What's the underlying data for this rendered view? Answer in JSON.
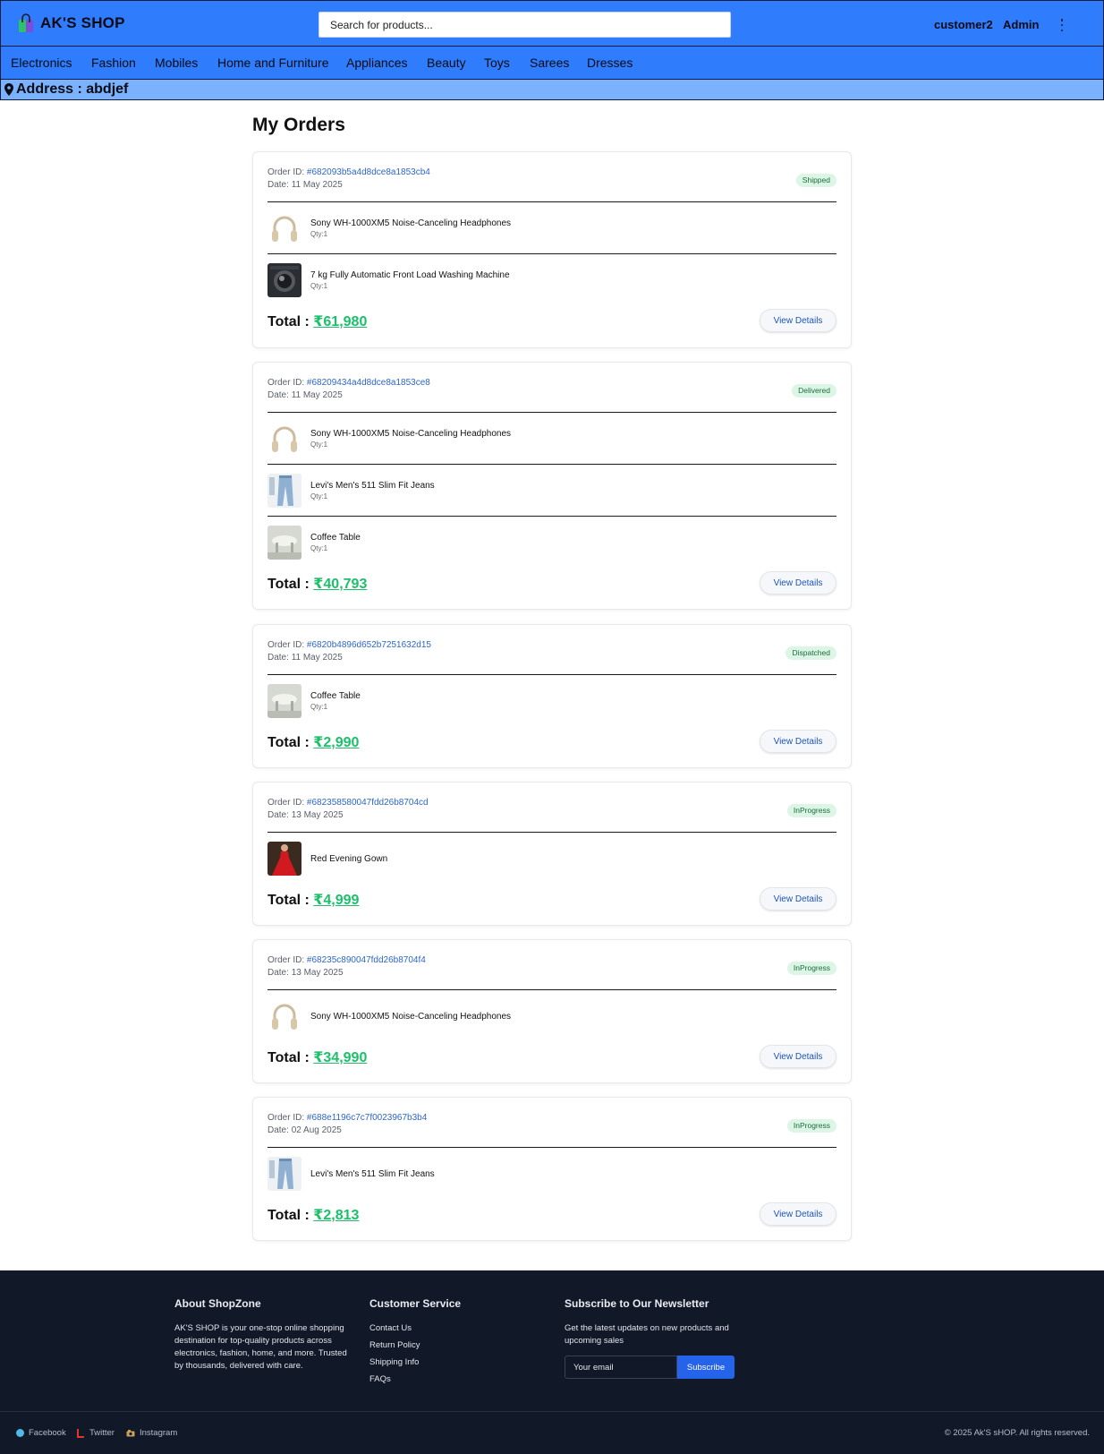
{
  "header": {
    "brand": "AK'S SHOP",
    "search_placeholder": "Search for products...",
    "user": "customer2",
    "admin": "Admin"
  },
  "categories": [
    "Electronics",
    "Fashion",
    "Mobiles",
    "Home and Furniture",
    "Appliances",
    "Beauty",
    "Toys",
    "Sarees",
    "Dresses"
  ],
  "address": "Address : abdjef",
  "page_title": "My Orders",
  "labels": {
    "order_id": "Order ID:",
    "date": "Date:",
    "qty": "Qty:1",
    "total": "Total :",
    "view_details": "View Details"
  },
  "orders": [
    {
      "id": "#682093b5a4d8dce8a1853cb4",
      "date": "11 May 2025",
      "status": "Shipped",
      "items": [
        {
          "name": "Sony WH-1000XM5 Noise-Canceling Headphones",
          "qty": "Qty:1",
          "thumb": "headphones"
        },
        {
          "name": "7 kg Fully Automatic Front Load Washing Machine",
          "qty": "Qty:1",
          "thumb": "washing-machine"
        }
      ],
      "total": "₹61,980"
    },
    {
      "id": "#68209434a4d8dce8a1853ce8",
      "date": "11 May 2025",
      "status": "Delivered",
      "items": [
        {
          "name": "Sony WH-1000XM5 Noise-Canceling Headphones",
          "qty": "Qty:1",
          "thumb": "headphones"
        },
        {
          "name": "Levi's Men's 511 Slim Fit Jeans",
          "qty": "Qty:1",
          "thumb": "jeans"
        },
        {
          "name": "Coffee Table",
          "qty": "Qty:1",
          "thumb": "coffee-table"
        }
      ],
      "total": "₹40,793"
    },
    {
      "id": "#6820b4896d652b7251632d15",
      "date": "11 May 2025",
      "status": "Dispatched",
      "items": [
        {
          "name": "Coffee Table",
          "qty": "Qty:1",
          "thumb": "coffee-table"
        }
      ],
      "total": "₹2,990"
    },
    {
      "id": "#682358580047fdd26b8704cd",
      "date": "13 May 2025",
      "status": "InProgress",
      "items": [
        {
          "name": "Red Evening Gown",
          "qty": "",
          "thumb": "gown"
        }
      ],
      "total": "₹4,999"
    },
    {
      "id": "#68235c890047fdd26b8704f4",
      "date": "13 May 2025",
      "status": "InProgress",
      "items": [
        {
          "name": "Sony WH-1000XM5 Noise-Canceling Headphones",
          "qty": "",
          "thumb": "headphones"
        }
      ],
      "total": "₹34,990"
    },
    {
      "id": "#688e1196c7c7f0023967b3b4",
      "date": "02 Aug 2025",
      "status": "InProgress",
      "items": [
        {
          "name": "Levi's Men's 511 Slim Fit Jeans",
          "qty": "",
          "thumb": "jeans"
        }
      ],
      "total": "₹2,813"
    }
  ],
  "footer": {
    "about_title": "About ShopZone",
    "about_text": "AK'S SHOP is your one-stop online shopping destination for top-quality products across electronics, fashion, home, and more. Trusted by thousands, delivered with care.",
    "service_title": "Customer Service",
    "service_links": [
      "Contact Us",
      "Return Policy",
      "Shipping Info",
      "FAQs"
    ],
    "newsletter_title": "Subscribe to Our Newsletter",
    "newsletter_text": "Get the latest updates on new products and upcoming sales",
    "email_placeholder": "Your email",
    "subscribe": "Subscribe",
    "social": [
      {
        "label": "Facebook",
        "icon": "facebook-icon",
        "color": "#4fb9e8"
      },
      {
        "label": "Twitter",
        "icon": "twitter-icon",
        "color": "#e0362b"
      },
      {
        "label": "Instagram",
        "icon": "instagram-icon",
        "color": "#c9a25a"
      }
    ],
    "copyright": "© 2025 Ak'S sHOP. All rights reserved."
  },
  "colors": {
    "header_blue": "#2f7dfc",
    "address_blue": "#7ab2fd",
    "total_green": "#1cc06a",
    "order_id_blue": "#2d66c9",
    "status_bg": "#dcf6e6",
    "footer_bg": "#111827",
    "subscribe_blue": "#2563eb"
  }
}
